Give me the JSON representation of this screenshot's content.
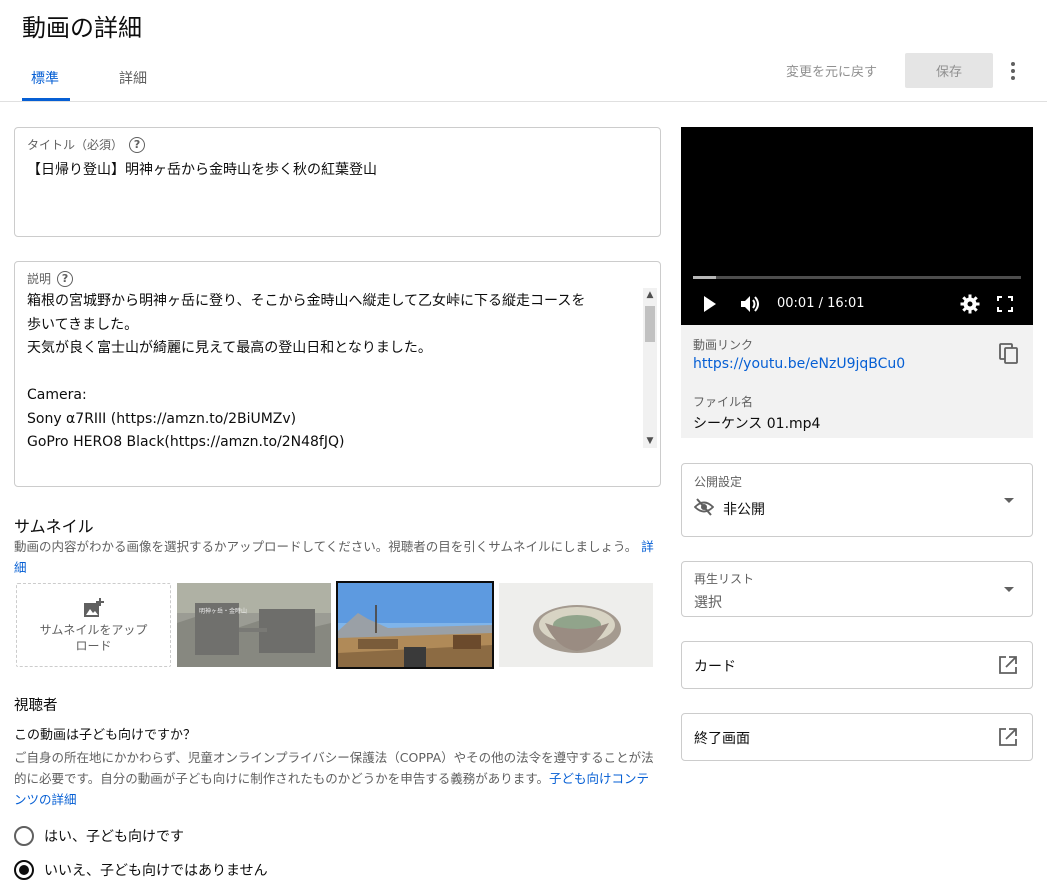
{
  "page": {
    "title": "動画の詳細"
  },
  "tabs": [
    {
      "label": "標準",
      "active": true
    },
    {
      "label": "詳細",
      "active": false
    }
  ],
  "toolbar": {
    "undo_label": "変更を元に戻す",
    "save_label": "保存"
  },
  "title_field": {
    "label": "タイトル（必須）",
    "value": "【日帰り登山】明神ヶ岳から金時山を歩く秋の紅葉登山"
  },
  "description_field": {
    "label": "説明",
    "lines": [
      "箱根の宮城野から明神ヶ岳に登り、そこから金時山へ縦走して乙女峠に下る縦走コースを",
      "歩いてきました。",
      "天気が良く富士山が綺麗に見えて最高の登山日和となりました。",
      "",
      "Camera:",
      "Sony α7RIII (https://amzn.to/2BiUMZv)",
      "GoPro HERO8 Black(https://amzn.to/2N48fJQ)"
    ]
  },
  "thumbnail": {
    "title": "サムネイル",
    "desc": "動画の内容がわかる画像を選択するかアップロードしてください。視聴者の目を引くサムネイルにしましょう。",
    "detail_link": "詳細",
    "upload_label": "サムネイルをアップロード",
    "sign_line1": "明神ヶ岳・金時山"
  },
  "audience": {
    "title": "視聴者",
    "question": "この動画は子ども向けですか？",
    "desc": "ご自身の所在地にかかわらず、児童オンラインプライバシー保護法（COPPA）やその他の法令を遵守することが法的に必要です。自分の動画が子ども向けに制作されたものかどうかを申告する義務があります。",
    "desc_link": "子ども向けコンテンツの詳細",
    "options": [
      {
        "label": "はい、子ども向けです",
        "checked": false
      },
      {
        "label": "いいえ、子ども向けではありません",
        "checked": true
      }
    ]
  },
  "player": {
    "time": "00:01 / 16:01",
    "progress": 0.07
  },
  "video_info": {
    "link_label": "動画リンク",
    "link_value": "https://youtu.be/eNzU9jqBCu0",
    "file_label": "ファイル名",
    "file_value": "シーケンス 01.mp4"
  },
  "visibility": {
    "label": "公開設定",
    "value": "非公開"
  },
  "playlist": {
    "label": "再生リスト",
    "value": "選択"
  },
  "cards": {
    "label": "カード"
  },
  "end_screen": {
    "label": "終了画面"
  },
  "colors": {
    "accent": "#065fd4",
    "border": "#cccccc",
    "muted": "#606060"
  }
}
